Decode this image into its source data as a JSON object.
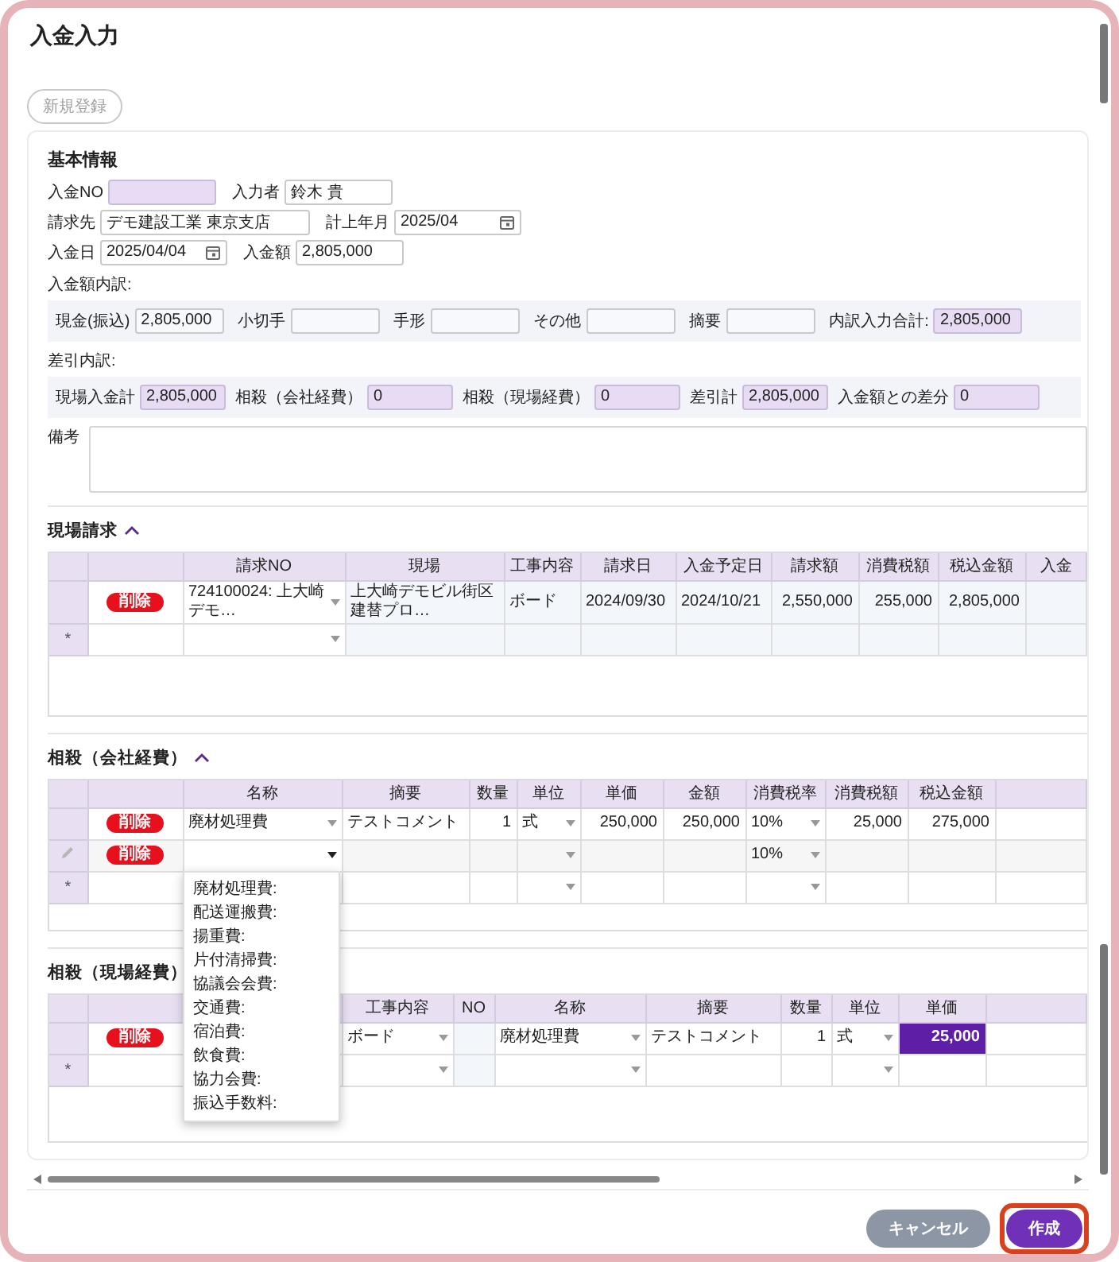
{
  "dialog": {
    "title": "入金入力"
  },
  "toolbar": {
    "new_button": {
      "label": "新規登録",
      "disabled": true
    }
  },
  "basic_info": {
    "heading": "基本情報",
    "rows": [
      {
        "fields": [
          {
            "label": "入金NO",
            "kind": "text",
            "readonly": true
          },
          {
            "label": "入力者",
            "value": "鈴木 貴",
            "kind": "text",
            "readonly": false
          }
        ]
      },
      {
        "fields": [
          {
            "label": "請求先",
            "value": "デモ建設工業 東京支店",
            "kind": "text",
            "readonly": false
          },
          {
            "label": "計上年月",
            "value": "2025/04",
            "kind": "date",
            "readonly": false
          }
        ]
      },
      {
        "fields": [
          {
            "label": "入金日",
            "value": "2025/04/04",
            "kind": "date",
            "readonly": false
          },
          {
            "label": "入金額",
            "value": "2,805,000",
            "kind": "text",
            "readonly": false
          }
        ]
      }
    ],
    "breakdown": {
      "heading": "入金額内訳:",
      "fields": [
        {
          "label": "現金(振込)",
          "value": "2,805,000",
          "kind": "text",
          "readonly": false
        },
        {
          "label": "小切手",
          "kind": "text",
          "readonly": false
        },
        {
          "label": "手形",
          "kind": "text",
          "readonly": false
        },
        {
          "label": "その他",
          "kind": "text",
          "readonly": false
        },
        {
          "label": "摘要",
          "kind": "text",
          "readonly": false
        },
        {
          "label": "内訳入力合計:",
          "value": "2,805,000",
          "kind": "text",
          "readonly": true
        }
      ]
    },
    "deductions": {
      "heading": "差引内訳:",
      "fields": [
        {
          "label": "現場入金計",
          "value": "2,805,000",
          "kind": "text",
          "readonly": true
        },
        {
          "label": "相殺（会社経費）",
          "value": "0",
          "kind": "text",
          "readonly": true
        },
        {
          "label": "相殺（現場経費）",
          "value": "0",
          "kind": "text",
          "readonly": true
        },
        {
          "label": "差引計",
          "value": "2,805,000",
          "kind": "text",
          "readonly": true
        },
        {
          "label": "入金額との差分",
          "value": "0",
          "kind": "text",
          "readonly": true
        }
      ]
    },
    "remarks": {
      "label": "備考"
    }
  },
  "sections": [
    {
      "title": "現場請求",
      "expanded": true,
      "columns": [
        {
          "label": "請求NO",
          "numeric": false,
          "readonly": false
        },
        {
          "label": "現場",
          "numeric": false,
          "readonly": true
        },
        {
          "label": "工事内容",
          "numeric": false,
          "readonly": true
        },
        {
          "label": "請求日",
          "numeric": false,
          "readonly": true
        },
        {
          "label": "入金予定日",
          "numeric": false,
          "readonly": true
        },
        {
          "label": "請求額",
          "numeric": true,
          "readonly": true
        },
        {
          "label": "消費税額",
          "numeric": true,
          "readonly": true
        },
        {
          "label": "税込金額",
          "numeric": true,
          "readonly": true
        },
        {
          "label": "入金",
          "readonly": true
        }
      ],
      "rows": [
        {
          "kind": "data",
          "delete_label": "削除",
          "cells": [
            {
              "text": "724100024: 上大崎デモ…",
              "dropdown": true,
              "selected": false
            },
            {
              "text": "上大崎デモビル街区建替プロ…",
              "dropdown": false,
              "selected": false
            },
            {
              "text": "ボード",
              "dropdown": false,
              "selected": false
            },
            {
              "text": "2024/09/30",
              "dropdown": false,
              "selected": false
            },
            {
              "text": "2024/10/21",
              "dropdown": false,
              "selected": false
            },
            {
              "text": "2,550,000",
              "dropdown": false,
              "selected": false
            },
            {
              "text": "255,000",
              "dropdown": false,
              "selected": false
            },
            {
              "text": "2,805,000",
              "dropdown": false,
              "selected": false
            },
            {
              "dropdown": false,
              "selected": false
            }
          ]
        },
        {
          "kind": "new",
          "marker": "*",
          "cells": [
            {
              "dropdown": true,
              "selected": false
            },
            {
              "dropdown": false,
              "selected": false
            },
            {
              "dropdown": false,
              "selected": false
            },
            {
              "dropdown": false,
              "selected": false
            },
            {
              "dropdown": false,
              "selected": false
            },
            {
              "dropdown": false,
              "selected": false
            },
            {
              "dropdown": false,
              "selected": false
            },
            {
              "dropdown": false,
              "selected": false
            },
            {
              "dropdown": false,
              "selected": false
            }
          ]
        }
      ]
    },
    {
      "title": "相殺（会社経費）",
      "expanded": true,
      "columns": [
        {
          "label": "名称",
          "numeric": false,
          "readonly": false
        },
        {
          "label": "摘要",
          "numeric": false,
          "readonly": false
        },
        {
          "label": "数量",
          "numeric": true,
          "readonly": false
        },
        {
          "label": "単位",
          "numeric": false,
          "readonly": false
        },
        {
          "label": "単価",
          "numeric": true,
          "readonly": false
        },
        {
          "label": "金額",
          "numeric": true,
          "readonly": false
        },
        {
          "label": "消費税率",
          "numeric": false,
          "readonly": false
        },
        {
          "label": "消費税額",
          "numeric": true,
          "readonly": false
        },
        {
          "label": "税込金額",
          "numeric": true,
          "readonly": false
        },
        {
          "readonly": false
        }
      ],
      "rows": [
        {
          "kind": "data",
          "delete_label": "削除",
          "cells": [
            {
              "text": "廃材処理費",
              "dropdown": true,
              "selected": false
            },
            {
              "text": "テストコメント",
              "dropdown": false,
              "selected": false
            },
            {
              "text": "1",
              "dropdown": false,
              "selected": false
            },
            {
              "text": "式",
              "dropdown": true,
              "selected": false
            },
            {
              "text": "250,000",
              "dropdown": false,
              "selected": false
            },
            {
              "text": "250,000",
              "dropdown": false,
              "selected": false
            },
            {
              "text": "10%",
              "dropdown": true,
              "selected": false
            },
            {
              "text": "25,000",
              "dropdown": false,
              "selected": false
            },
            {
              "text": "275,000",
              "dropdown": false,
              "selected": false
            },
            {
              "dropdown": false,
              "selected": false
            }
          ]
        },
        {
          "kind": "editing",
          "delete_label": "削除",
          "cells": [
            {
              "dropdown": true,
              "selected": false,
              "open": true,
              "options": [
                "廃材処理費:",
                "配送運搬費:",
                "揚重費:",
                "片付清掃費:",
                "協議会会費:",
                "交通費:",
                "宿泊費:",
                "飲食費:",
                "協力会費:",
                "振込手数料:"
              ]
            },
            {
              "dropdown": false,
              "selected": false
            },
            {
              "dropdown": false,
              "selected": false
            },
            {
              "dropdown": true,
              "selected": false
            },
            {
              "dropdown": false,
              "selected": false
            },
            {
              "dropdown": false,
              "selected": false
            },
            {
              "text": "10%",
              "dropdown": true,
              "selected": false
            },
            {
              "dropdown": false,
              "selected": false
            },
            {
              "dropdown": false,
              "selected": false
            },
            {
              "dropdown": false,
              "selected": false
            }
          ]
        },
        {
          "kind": "new",
          "marker": "*",
          "cells": [
            {
              "dropdown": false,
              "selected": false
            },
            {
              "dropdown": false,
              "selected": false
            },
            {
              "dropdown": false,
              "selected": false
            },
            {
              "dropdown": true,
              "selected": false
            },
            {
              "dropdown": false,
              "selected": false
            },
            {
              "dropdown": false,
              "selected": false
            },
            {
              "dropdown": true,
              "selected": false
            },
            {
              "dropdown": false,
              "selected": false
            },
            {
              "dropdown": false,
              "selected": false
            },
            {
              "dropdown": false,
              "selected": false
            }
          ]
        }
      ]
    },
    {
      "title": "相殺（現場経費）",
      "expanded": true,
      "columns": [
        {},
        {
          "label": "工事内容",
          "numeric": false,
          "readonly": false
        },
        {
          "label": "NO",
          "numeric": false,
          "readonly": true
        },
        {
          "label": "名称",
          "numeric": false,
          "readonly": false
        },
        {
          "label": "摘要",
          "numeric": false,
          "readonly": false
        },
        {
          "label": "数量",
          "numeric": true,
          "readonly": false
        },
        {
          "label": "単位",
          "numeric": false,
          "readonly": false
        },
        {
          "label": "単価",
          "numeric": true,
          "readonly": false
        },
        {
          "readonly": false
        }
      ],
      "rows": [
        {
          "kind": "data",
          "delete_label": "削除",
          "cells": [
            {
              "dropdown": false,
              "selected": false
            },
            {
              "text": "ボード",
              "dropdown": true,
              "selected": false
            },
            {
              "dropdown": false,
              "selected": false
            },
            {
              "text": "廃材処理費",
              "dropdown": true,
              "selected": false
            },
            {
              "text": "テストコメント",
              "dropdown": false,
              "selected": false
            },
            {
              "text": "1",
              "dropdown": false,
              "selected": false
            },
            {
              "text": "式",
              "dropdown": true,
              "selected": false
            },
            {
              "text": "25,000",
              "dropdown": false,
              "selected": true
            },
            {
              "dropdown": false,
              "selected": false
            }
          ]
        },
        {
          "kind": "new",
          "marker": "*",
          "cells": [
            {
              "dropdown": false,
              "selected": false
            },
            {
              "dropdown": true,
              "selected": false
            },
            {
              "dropdown": false,
              "selected": false
            },
            {
              "dropdown": true,
              "selected": false
            },
            {
              "dropdown": false,
              "selected": false
            },
            {
              "dropdown": false,
              "selected": false
            },
            {
              "dropdown": true,
              "selected": false
            },
            {
              "dropdown": false,
              "selected": false
            },
            {
              "dropdown": false,
              "selected": false
            }
          ]
        }
      ]
    }
  ],
  "footer": {
    "buttons": [
      {
        "label": "キャンセル",
        "kind": "secondary",
        "highlighted": false
      },
      {
        "label": "作成",
        "kind": "primary",
        "highlighted": true
      }
    ]
  }
}
